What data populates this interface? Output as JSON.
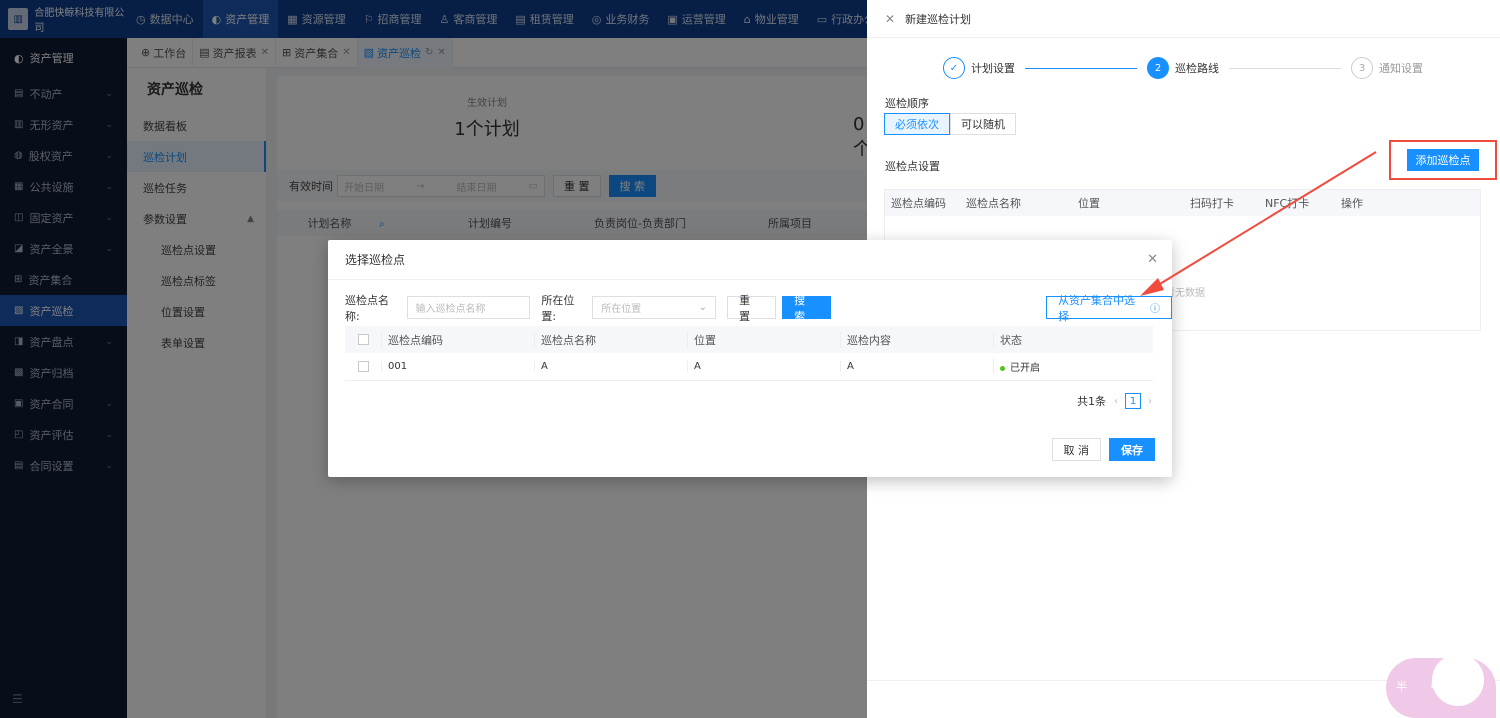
{
  "topnav": {
    "company": "合肥快鲸科技有限公司",
    "items": [
      {
        "label": "数据中心",
        "icon": "dashboard-icon",
        "glyph": "◷"
      },
      {
        "label": "资产管理",
        "icon": "asset-icon",
        "glyph": "◐"
      },
      {
        "label": "资源管理",
        "icon": "resource-icon",
        "glyph": "▦"
      },
      {
        "label": "招商管理",
        "icon": "merchant-icon",
        "glyph": "⚐"
      },
      {
        "label": "客商管理",
        "icon": "customer-icon",
        "glyph": "♙"
      },
      {
        "label": "租赁管理",
        "icon": "lease-icon",
        "glyph": "▤"
      },
      {
        "label": "业务财务",
        "icon": "finance-icon",
        "glyph": "◎"
      },
      {
        "label": "运营管理",
        "icon": "operation-icon",
        "glyph": "▣"
      },
      {
        "label": "物业管理",
        "icon": "property-icon",
        "glyph": "⌂"
      },
      {
        "label": "行政办公",
        "icon": "office-icon",
        "glyph": "▭"
      }
    ]
  },
  "sidebar": {
    "title": "资产管理",
    "items": [
      {
        "label": "不动产",
        "glyph": "▤",
        "chev": true
      },
      {
        "label": "无形资产",
        "glyph": "▥",
        "chev": true
      },
      {
        "label": "股权资产",
        "glyph": "◍",
        "chev": true
      },
      {
        "label": "公共设施",
        "glyph": "▦",
        "chev": true
      },
      {
        "label": "固定资产",
        "glyph": "◫",
        "chev": true
      },
      {
        "label": "资产全景",
        "glyph": "◪",
        "chev": true
      },
      {
        "label": "资产集合",
        "glyph": "⊞",
        "chev": false
      },
      {
        "label": "资产巡检",
        "glyph": "▧",
        "chev": false
      },
      {
        "label": "资产盘点",
        "glyph": "◨",
        "chev": true
      },
      {
        "label": "资产归档",
        "glyph": "▩",
        "chev": false
      },
      {
        "label": "资产合同",
        "glyph": "▣",
        "chev": true
      },
      {
        "label": "资产评估",
        "glyph": "◰",
        "chev": true
      },
      {
        "label": "合同设置",
        "glyph": "▤",
        "chev": true
      }
    ],
    "bottom_icon": "☰"
  },
  "tabs": [
    {
      "label": "工作台",
      "glyph": "⊕",
      "close": false
    },
    {
      "label": "资产报表",
      "glyph": "▤",
      "close": true
    },
    {
      "label": "资产集合",
      "glyph": "⊞",
      "close": true
    },
    {
      "label": "资产巡检",
      "glyph": "▧",
      "close": true
    }
  ],
  "subside": {
    "title": "资产巡检",
    "items": [
      "数据看板",
      "巡检计划",
      "巡检任务",
      "参数设置"
    ],
    "children": [
      "巡检点设置",
      "巡检点标签",
      "位置设置",
      "表单设置"
    ]
  },
  "main": {
    "stat1_label": "生效计划",
    "stat1_value": "1个计划",
    "stat2_value": "0个",
    "filter_label": "有效时间",
    "date_start": "开始日期",
    "date_sep": "→",
    "date_end": "结束日期",
    "reset": "重 置",
    "search": "搜 索",
    "columns": [
      "计划名称",
      "计划编号",
      "负责岗位-负责部门",
      "所属项目"
    ]
  },
  "drawer": {
    "title": "新建巡检计划",
    "steps": [
      {
        "num": "✓",
        "label": "计划设置"
      },
      {
        "num": "2",
        "label": "巡检路线"
      },
      {
        "num": "3",
        "label": "通知设置"
      }
    ],
    "order_label": "巡检顺序",
    "order_options": [
      "必须依次",
      "可以随机"
    ],
    "points_label": "巡检点设置",
    "add_point": "添加巡检点",
    "table_cols": [
      "巡检点编码",
      "巡检点名称",
      "位置",
      "扫码打卡",
      "NFC打卡",
      "操作"
    ],
    "nodata": "暂无数据"
  },
  "modal": {
    "title": "选择巡检点",
    "name_label": "巡检点名称:",
    "name_placeholder": "输入巡检点名称",
    "loc_label": "所在位置:",
    "loc_placeholder": "所在位置",
    "reset": "重 置",
    "search": "搜 索",
    "from_collection": "从资产集合中选择",
    "columns": [
      "巡检点编码",
      "巡检点名称",
      "位置",
      "巡检内容",
      "状态"
    ],
    "rows": [
      {
        "code": "001",
        "name": "A",
        "location": "A",
        "content": "A",
        "status": "已开启"
      }
    ],
    "total": "共1条",
    "page": "1",
    "cancel": "取 消",
    "save": "保存"
  },
  "mascot": {
    "text": "半 中"
  },
  "colors": {
    "primary": "#1890ff",
    "nav": "#0e3f8f",
    "sidebar": "#0f1a33",
    "annotation": "#f04b3d",
    "status_on": "#52c41a"
  }
}
